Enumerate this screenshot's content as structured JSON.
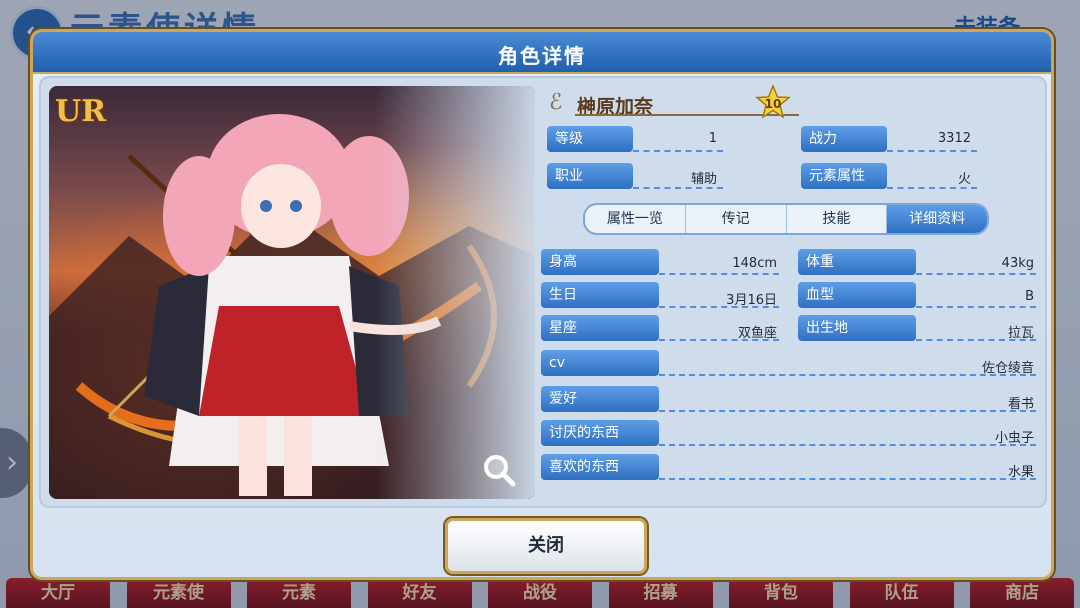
{
  "background": {
    "screen_title": "元素使详情",
    "right_title": "未装备",
    "bottom_nav": [
      "大厅",
      "元素使",
      "元素",
      "好友",
      "战役",
      "招募",
      "背包",
      "队伍",
      "商店"
    ]
  },
  "modal": {
    "title": "角色详情",
    "close_label": "关闭"
  },
  "character": {
    "rarity": "UR",
    "name": "榊原加奈",
    "star_level": "10",
    "level_label": "等级",
    "level_value": "1",
    "power_label": "战力",
    "power_value": "3312",
    "job_label": "职业",
    "job_value": "辅助",
    "element_label": "元素属性",
    "element_value": "火"
  },
  "tabs": [
    {
      "label": "属性一览",
      "active": false
    },
    {
      "label": "传记",
      "active": false
    },
    {
      "label": "技能",
      "active": false
    },
    {
      "label": "详细资料",
      "active": true
    }
  ],
  "details": {
    "height_label": "身高",
    "height_value": "148cm",
    "weight_label": "体重",
    "weight_value": "43kg",
    "birthday_label": "生日",
    "birthday_value": "3月16日",
    "blood_label": "血型",
    "blood_value": "B",
    "sign_label": "星座",
    "sign_value": "双鱼座",
    "birthplace_label": "出生地",
    "birthplace_value": "拉瓦",
    "cv_label": "cv",
    "cv_value": "佐仓绫音",
    "hobby_label": "爱好",
    "hobby_value": "看书",
    "dislike_label": "讨厌的东西",
    "dislike_value": "小虫子",
    "like_label": "喜欢的东西",
    "like_value": "水果"
  },
  "colors": {
    "accent_blue": "#2f6fc2",
    "gold_border": "#c9a85b",
    "nav_red": "#c81f25"
  }
}
